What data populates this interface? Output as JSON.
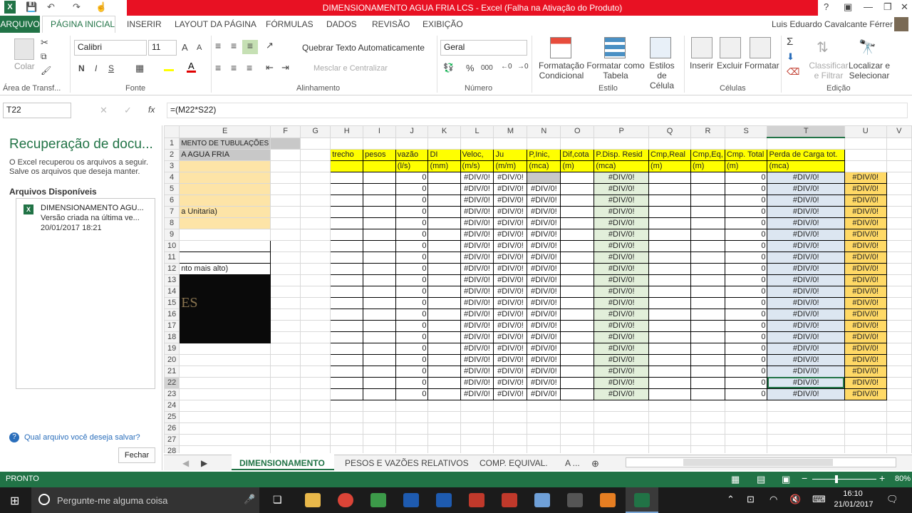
{
  "window": {
    "title": "DIMENSIONAMENTO AGUA FRIA LCS -  Excel (Falha na Ativação do Produto)",
    "help": "?",
    "user": "Luis Eduardo Cavalcante Férrer"
  },
  "tabs": [
    "ARQUIVO",
    "PÁGINA INICIAL",
    "INSERIR",
    "LAYOUT DA PÁGINA",
    "FÓRMULAS",
    "DADOS",
    "REVISÃO",
    "EXIBIÇÃO"
  ],
  "ribbon": {
    "clipboard": {
      "paste": "Colar",
      "group": "Área de Transf..."
    },
    "font": {
      "name": "Calibri",
      "size": "11",
      "bold": "N",
      "italic": "I",
      "underline": "S",
      "group": "Fonte",
      "grow": "A",
      "shrink": "A"
    },
    "alignment": {
      "wrap": "Quebrar Texto Automaticamente",
      "merge": "Mesclar e Centralizar",
      "group": "Alinhamento"
    },
    "number": {
      "format": "Geral",
      "percent": "%",
      "thousands": "000",
      "group": "Número"
    },
    "styles": {
      "cond": "Formatação\nCondicional",
      "table": "Formatar como\nTabela",
      "cell": "Estilos de\nCélula",
      "group": "Estilo"
    },
    "cells": {
      "insert": "Inserir",
      "delete": "Excluir",
      "format": "Formatar",
      "group": "Células"
    },
    "editing": {
      "sort": "Classificar\ne Filtrar",
      "find": "Localizar e\nSelecionar",
      "group": "Edição"
    }
  },
  "formula_bar": {
    "name_box": "T22",
    "fx": "fx",
    "formula": "=(M22*S22)"
  },
  "recovery": {
    "title": "Recuperação de docu...",
    "desc1": "O Excel recuperou os arquivos a seguir.",
    "desc2": "Salve os arquivos que deseja manter.",
    "available": "Arquivos Disponíveis",
    "file_name": "DIMENSIONAMENTO AGU...",
    "file_desc": "Versão criada na última ve...",
    "file_date": "20/01/2017 18:21",
    "question": "Qual arquivo você deseja salvar?",
    "close": "Fechar"
  },
  "columns": [
    "E",
    "F",
    "G",
    "H",
    "I",
    "J",
    "K",
    "L",
    "M",
    "N",
    "O",
    "P",
    "Q",
    "R",
    "S",
    "T",
    "U",
    "V"
  ],
  "headers": {
    "H": [
      "trecho",
      ""
    ],
    "I": [
      "pesos",
      ""
    ],
    "J": [
      "vazão",
      "(l/s)"
    ],
    "K": [
      "DI",
      "(mm)"
    ],
    "L": [
      "Veloc,",
      "(m/s)"
    ],
    "M": [
      "Ju",
      "(m/m)"
    ],
    "N": [
      "P,Inic,",
      "(mca)"
    ],
    "O": [
      "Dif,cota",
      "(m)"
    ],
    "P": [
      "P.Disp. Resid",
      "(mca)"
    ],
    "Q": [
      "Cmp,Real",
      "(m)"
    ],
    "R": [
      "Cmp,Eq,",
      "(m)"
    ],
    "S": [
      "Cmp. Total",
      "(m)"
    ],
    "T": [
      "Perda de Carga tot.",
      "(mca)"
    ]
  },
  "e_texts": {
    "1": "MENTO DE TUBULAÇÕES",
    "2": "A AGUA FRIA",
    "7": "a Unitaria)",
    "12": "nto mais alto)"
  },
  "values": {
    "zero": "0",
    "err": "#DIV/0!"
  },
  "sheet_tabs": [
    "DIMENSIONAMENTO",
    "PESOS E VAZÕES RELATIVOS",
    "COMP. EQUIVAL.",
    "A ..."
  ],
  "status": {
    "left": "PRONTO",
    "zoom": "80%"
  },
  "taskbar": {
    "search": "Pergunte-me alguma coisa",
    "time": "16:10",
    "date": "21/01/2017"
  }
}
